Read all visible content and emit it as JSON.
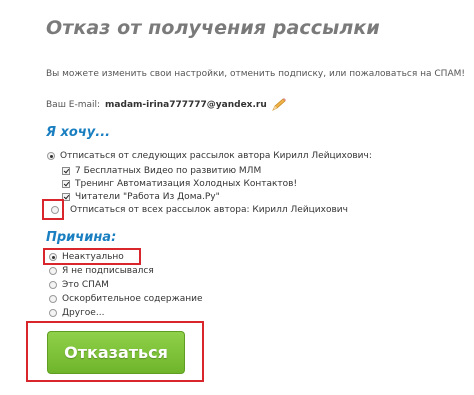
{
  "page": {
    "title": "Отказ от получения рассылки",
    "intro": "Вы можете изменить свои настройки, отменить подписку, или пожаловаться на СПАМ!",
    "email_label": "Ваш E-mail:",
    "email_value": "madam-irina777777@yandex.ru"
  },
  "want_section": {
    "heading": "Я хочу...",
    "option_selected_label": "Отписаться от следующих рассылок автора Кирилл Лейцихович:",
    "subscriptions": [
      {
        "label": "7 Бесплатных Видео по развитию МЛМ",
        "checked": true
      },
      {
        "label": "Тренинг Автоматизация Холодных Контактов!",
        "checked": true
      },
      {
        "label": "Читатели \"Работа Из Дома.Ру\"",
        "checked": true
      }
    ],
    "option_all_label": "Отписаться от всех рассылок автора: Кирилл Лейцихович"
  },
  "reason_section": {
    "heading": "Причина:",
    "options": [
      {
        "label": "Неактуально",
        "checked": true
      },
      {
        "label": "Я не подписывался",
        "checked": false
      },
      {
        "label": "Это СПАМ",
        "checked": false
      },
      {
        "label": "Оскорбительное содержание",
        "checked": false
      },
      {
        "label": "Другое...",
        "checked": false
      }
    ]
  },
  "submit": {
    "label": "Отказаться"
  },
  "colors": {
    "heading_blue": "#1a7fc1",
    "title_gray": "#7a7a7a",
    "button_green": "#7cc23a",
    "highlight_red": "#d9262d"
  }
}
